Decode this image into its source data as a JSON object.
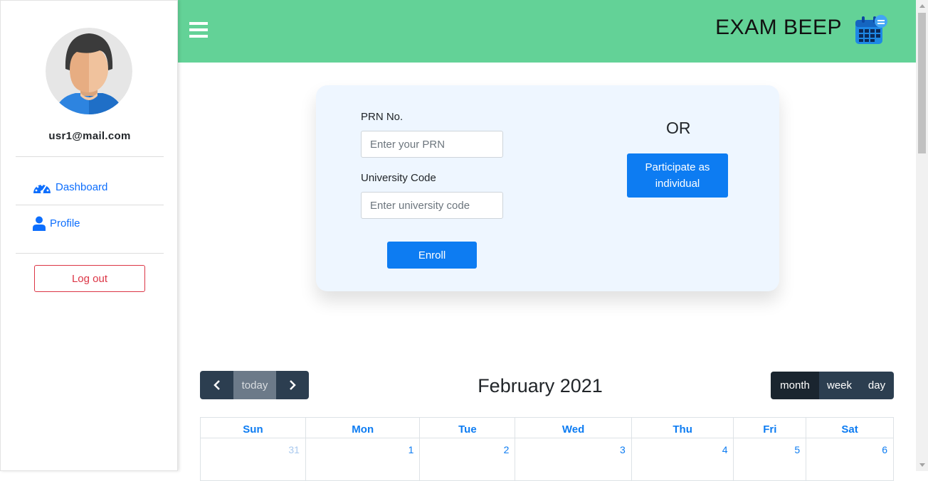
{
  "sidebar": {
    "user_email": "usr1@mail.com",
    "nav": [
      {
        "label": "Dashboard",
        "icon": "dashboard-gauge-icon"
      },
      {
        "label": "Profile",
        "icon": "user-icon"
      }
    ],
    "logout_label": "Log out"
  },
  "header": {
    "brand": "EXAM BEEP",
    "brand_icon": "calendar-icon",
    "menu_icon": "hamburger-menu-icon",
    "bg_color": "#63d297"
  },
  "enroll_form": {
    "prn_label": "PRN No.",
    "prn_placeholder": "Enter your PRN",
    "prn_value": "",
    "university_label": "University Code",
    "university_placeholder": "Enter university code",
    "university_value": "",
    "enroll_button": "Enroll",
    "or_text": "OR",
    "individual_button": "Participate as individual"
  },
  "calendar": {
    "title": "February 2021",
    "today_label": "today",
    "views": [
      {
        "label": "month",
        "active": true
      },
      {
        "label": "week",
        "active": false
      },
      {
        "label": "day",
        "active": false
      }
    ],
    "weekdays": [
      "Sun",
      "Mon",
      "Tue",
      "Wed",
      "Thu",
      "Fri",
      "Sat"
    ],
    "first_week": [
      {
        "day": "31",
        "other_month": true
      },
      {
        "day": "1",
        "other_month": false
      },
      {
        "day": "2",
        "other_month": false
      },
      {
        "day": "3",
        "other_month": false
      },
      {
        "day": "4",
        "other_month": false
      },
      {
        "day": "5",
        "other_month": false
      },
      {
        "day": "6",
        "other_month": false
      }
    ]
  },
  "colors": {
    "primary": "#0d7cf2",
    "danger": "#dc3545",
    "calendar_dark": "#2c3e50"
  }
}
